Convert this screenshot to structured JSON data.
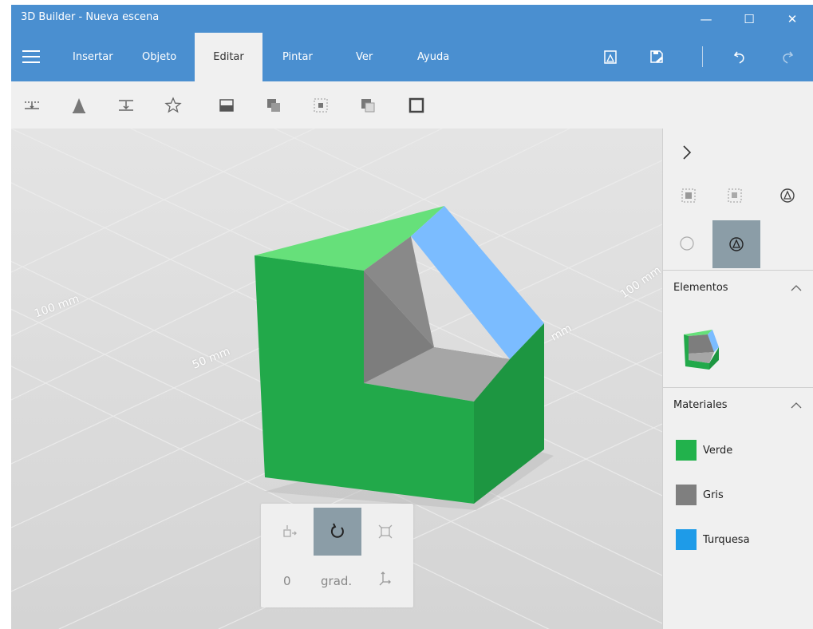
{
  "window": {
    "title": "3D Builder - Nueva escena",
    "minimize_label": "—",
    "maximize_label": "☐",
    "close_label": "✕"
  },
  "ribbon": {
    "tabs": [
      {
        "label": "Insertar"
      },
      {
        "label": "Objeto"
      },
      {
        "label": "Editar"
      },
      {
        "label": "Pintar"
      },
      {
        "label": "Ver"
      },
      {
        "label": "Ayuda"
      }
    ],
    "active_tab": "Editar"
  },
  "viewport": {
    "grid_labels": [
      "100 mm",
      "50 mm",
      "mm",
      "100 mm"
    ]
  },
  "rotate_panel": {
    "angle_value": "0",
    "angle_unit": "grad."
  },
  "side_panel": {
    "elements_title": "Elementos",
    "materials_title": "Materiales",
    "materials": [
      {
        "name": "Verde",
        "color": "#22b24c"
      },
      {
        "name": "Gris",
        "color": "#7f7f7f"
      },
      {
        "name": "Turquesa",
        "color": "#1e9be8"
      }
    ]
  },
  "colors": {
    "accent": "#4a8fd0",
    "active_button": "#8b9da7"
  }
}
